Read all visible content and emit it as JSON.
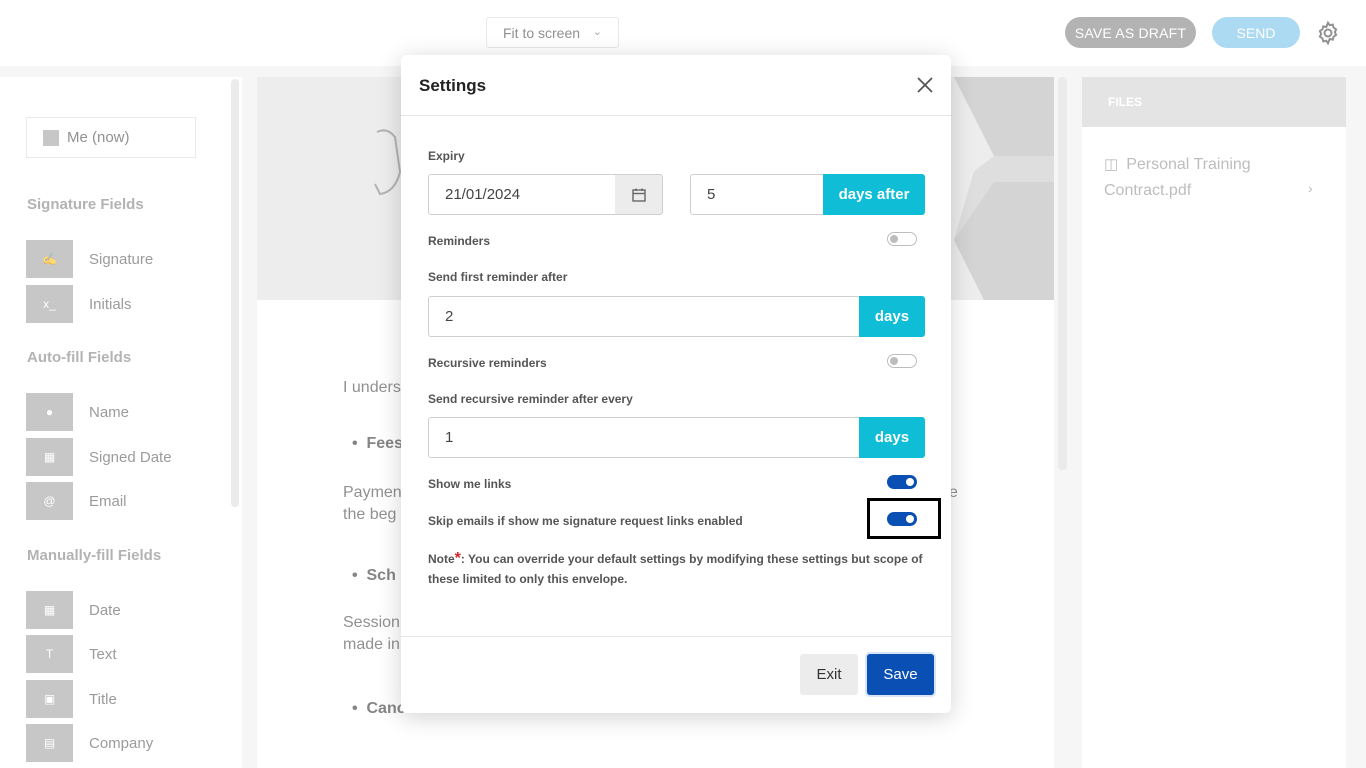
{
  "topbar": {
    "zoom_select": "Fit to screen",
    "save_draft_label": "SAVE AS DRAFT",
    "send_label": "SEND"
  },
  "left": {
    "signer": "Me (now)",
    "signature_section": "Signature Fields",
    "signature_fields": [
      "Signature",
      "Initials"
    ],
    "autofill_section": "Auto-fill Fields",
    "autofill_fields": [
      "Name",
      "Signed Date",
      "Email"
    ],
    "manual_section": "Manually-fill Fields",
    "manual_fields": [
      "Date",
      "Text",
      "Title",
      "Company"
    ]
  },
  "document": {
    "line1": "I unders",
    "bullet1": "Fees",
    "para1a": "Paymen",
    "para1b": "the beg",
    "para1_tail": "e",
    "bullet2": "Sch",
    "para2a": "Session",
    "para2b": "made in",
    "bullet3": "Cancellation"
  },
  "files": {
    "header": "FILES",
    "file_name": "Personal Training Contract.pdf"
  },
  "modal": {
    "title": "Settings",
    "expiry_label": "Expiry",
    "expiry_date": "21/01/2024",
    "expiry_days": "5",
    "expiry_addon": "days after",
    "reminders_label": "Reminders",
    "reminders_on": false,
    "first_reminder_label": "Send first reminder after",
    "first_reminder_value": "2",
    "first_reminder_addon": "days",
    "recursive_label": "Recursive reminders",
    "recursive_on": false,
    "recursive_every_label": "Send recursive reminder after every",
    "recursive_every_value": "1",
    "recursive_every_addon": "days",
    "show_links_label": "Show me links",
    "show_links_on": true,
    "skip_emails_label": "Skip emails if show me signature request links enabled",
    "skip_emails_on": true,
    "note_prefix": "Note",
    "note_star": "*",
    "note_text": ": You can override your default settings by modifying these settings but scope of these limited to only this envelope.",
    "exit_label": "Exit",
    "save_label": "Save"
  },
  "colors": {
    "accent_teal": "#0fbdd6",
    "primary_blue": "#0a4fb4",
    "send_light_blue": "#7ec7ec",
    "draft_gray": "#8a8a8a"
  },
  "icons": [
    "chevron-down-icon",
    "gear-icon",
    "close-icon",
    "calendar-icon",
    "signature-icon",
    "initials-icon",
    "user-icon",
    "calendar-icon",
    "at-icon",
    "text-icon",
    "badge-icon",
    "building-icon",
    "file-icon",
    "chevron-right-icon"
  ]
}
